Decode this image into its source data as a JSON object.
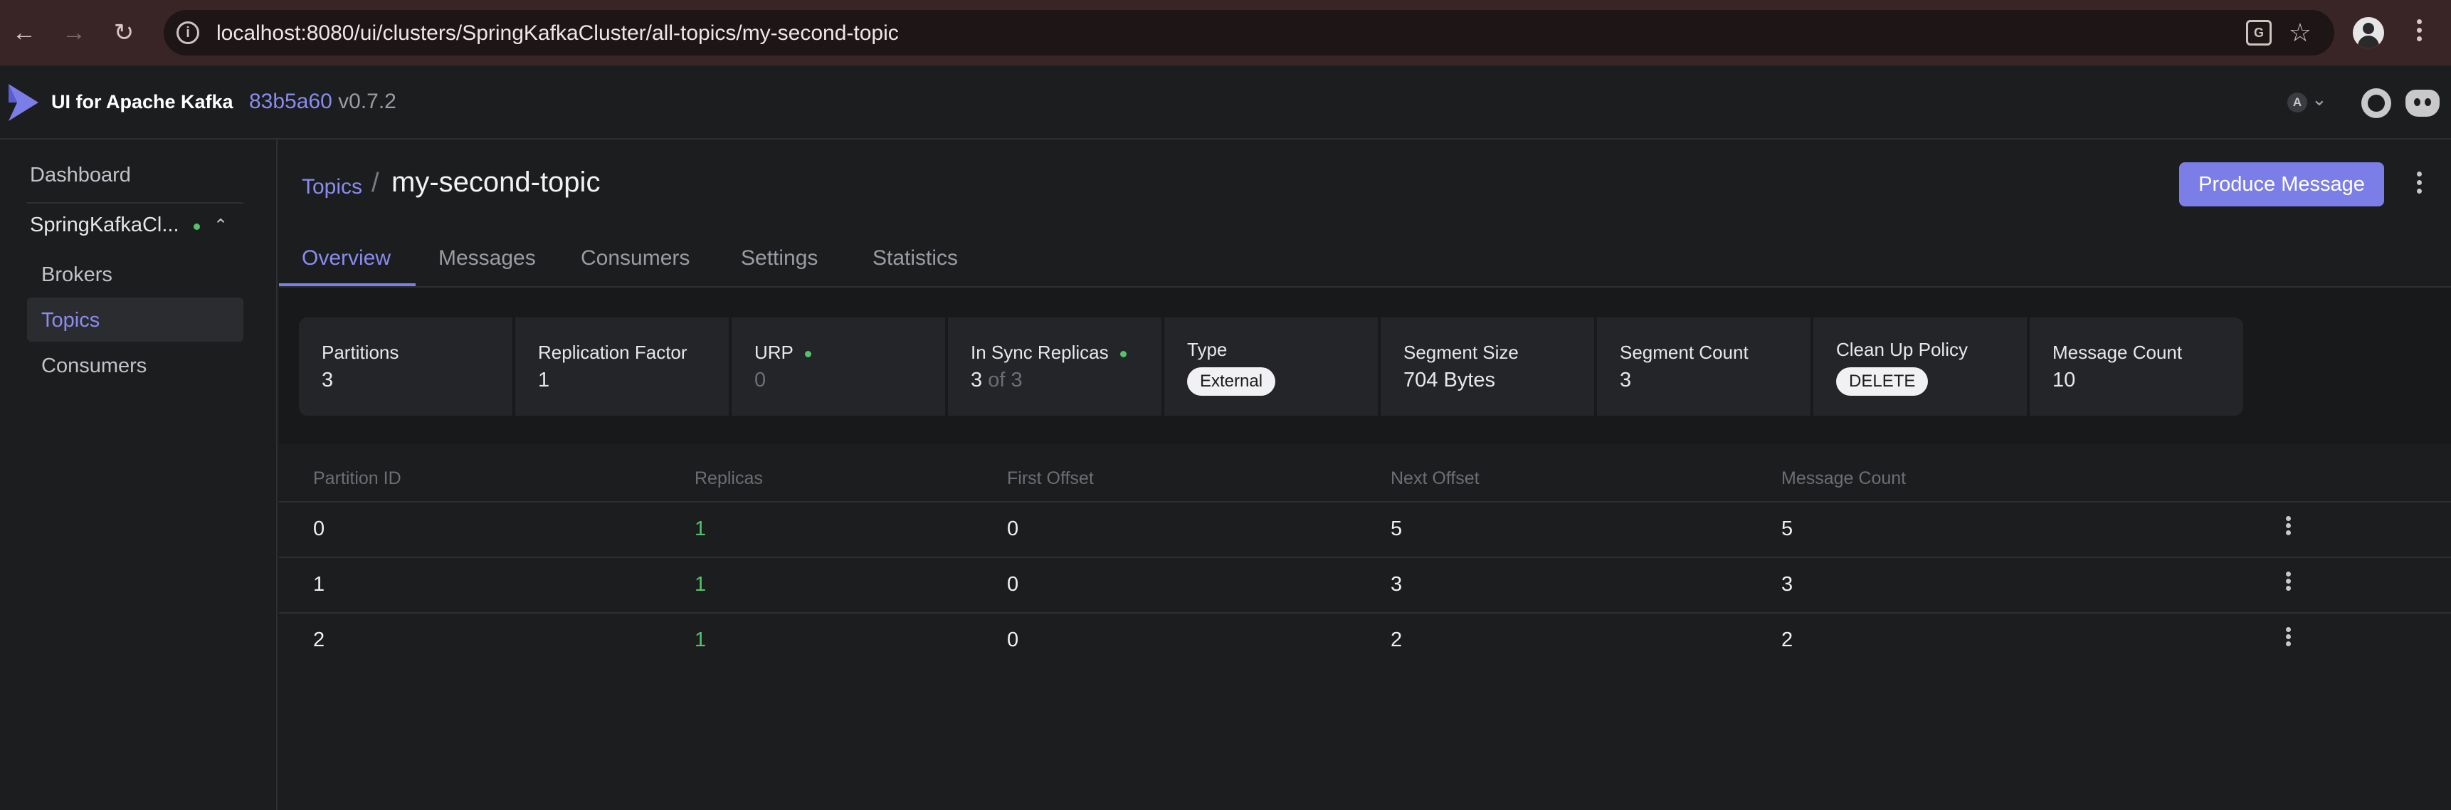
{
  "browser": {
    "url": "localhost:8080/ui/clusters/SpringKafkaCluster/all-topics/my-second-topic",
    "icons": [
      "back-icon",
      "forward-icon",
      "reload-icon",
      "site-info-icon",
      "translate-icon",
      "star-icon",
      "profile-icon",
      "more-icon"
    ]
  },
  "header": {
    "app_name": "UI for Apache Kafka",
    "version_hash": "83b5a60",
    "version_tag": "v0.7.2",
    "user_initial": "A"
  },
  "sidebar": {
    "dashboard": "Dashboard",
    "cluster_name": "SpringKafkaCl...",
    "items": [
      {
        "label": "Brokers"
      },
      {
        "label": "Topics",
        "active": true
      },
      {
        "label": "Consumers"
      }
    ]
  },
  "page": {
    "breadcrumb": "Topics",
    "separator": "/",
    "title": "my-second-topic",
    "produce_label": "Produce Message"
  },
  "tabs": [
    {
      "label": "Overview",
      "active": true
    },
    {
      "label": "Messages"
    },
    {
      "label": "Consumers"
    },
    {
      "label": "Settings"
    },
    {
      "label": "Statistics"
    }
  ],
  "stats": {
    "partitions": {
      "label": "Partitions",
      "value": "3"
    },
    "replication_factor": {
      "label": "Replication Factor",
      "value": "1"
    },
    "urp": {
      "label": "URP",
      "value": "0"
    },
    "in_sync": {
      "label": "In Sync Replicas",
      "value": "3",
      "of": "of 3"
    },
    "type": {
      "label": "Type",
      "value": "External"
    },
    "segment_size": {
      "label": "Segment Size",
      "value": "704 Bytes"
    },
    "segment_count": {
      "label": "Segment Count",
      "value": "3"
    },
    "cleanup": {
      "label": "Clean Up Policy",
      "value": "DELETE"
    },
    "message_count": {
      "label": "Message Count",
      "value": "10"
    }
  },
  "table": {
    "headers": [
      "Partition ID",
      "Replicas",
      "First Offset",
      "Next Offset",
      "Message Count"
    ],
    "rows": [
      [
        "0",
        "1",
        "0",
        "5",
        "5"
      ],
      [
        "1",
        "1",
        "0",
        "3",
        "3"
      ],
      [
        "2",
        "1",
        "0",
        "2",
        "2"
      ]
    ]
  },
  "colors": {
    "accent": "#7b7ee6",
    "link": "#8a8cf0",
    "status_green": "#54c26b",
    "background": "#1c1d1f",
    "browser_frame": "#3a2526"
  }
}
